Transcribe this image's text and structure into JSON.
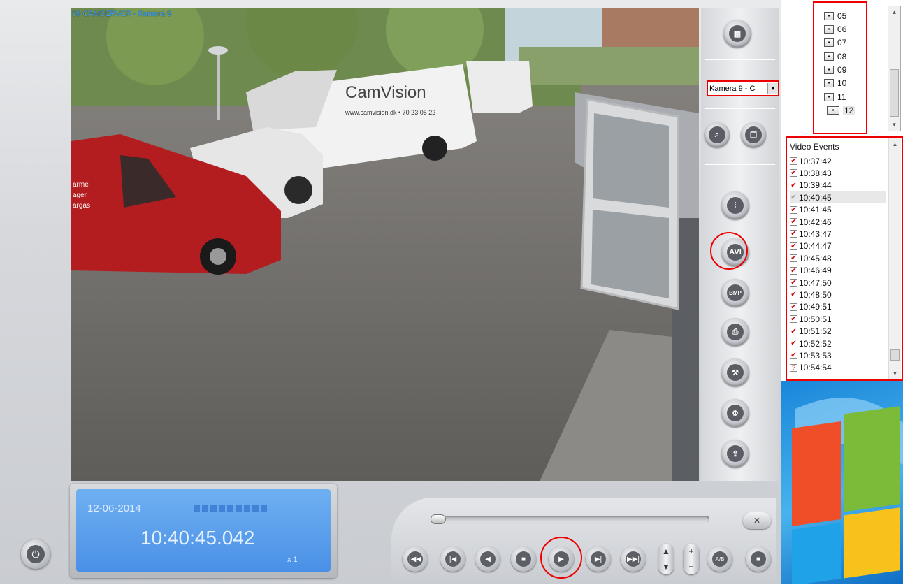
{
  "window": {
    "camera_title": "09 CAMSERVER - Kamera 9"
  },
  "video": {
    "van_logo": "CamVision",
    "van_url": "www.camvision.dk • 70 23 05 22",
    "red_van_text": [
      "arme",
      "ager",
      "argas"
    ]
  },
  "camera_select": {
    "value": "Kamera 9 - C",
    "arrow_icon": "dropdown-arrow-icon"
  },
  "right_buttons": [
    {
      "name": "camera-layout-button",
      "icon": "layout-grid-icon"
    },
    {
      "name": "search-button",
      "icon": "magnifier-icon"
    },
    {
      "name": "copy-button",
      "icon": "copy-pages-icon"
    },
    {
      "name": "adjust-button",
      "icon": "sliders-icon"
    },
    {
      "name": "save-avi-button",
      "icon": "floppy-avi-icon",
      "label": "AVI"
    },
    {
      "name": "save-bmp-button",
      "icon": "floppy-bmp-icon",
      "label": "BMP"
    },
    {
      "name": "print-button",
      "icon": "printer-icon"
    },
    {
      "name": "tools-button",
      "icon": "tools-icon"
    },
    {
      "name": "settings-button",
      "icon": "gear-wrench-icon"
    },
    {
      "name": "export-button",
      "icon": "export-icon"
    }
  ],
  "tree": {
    "items": [
      "05",
      "06",
      "07",
      "08",
      "09",
      "10",
      "11",
      "12"
    ]
  },
  "events": {
    "header": "Video Events",
    "items": [
      {
        "time": "10:37:42",
        "state": "checked"
      },
      {
        "time": "10:38:43",
        "state": "checked"
      },
      {
        "time": "10:39:44",
        "state": "checked"
      },
      {
        "time": "10:40:45",
        "state": "current"
      },
      {
        "time": "10:41:45",
        "state": "checked"
      },
      {
        "time": "10:42:46",
        "state": "checked"
      },
      {
        "time": "10:43:47",
        "state": "checked"
      },
      {
        "time": "10:44:47",
        "state": "checked"
      },
      {
        "time": "10:45:48",
        "state": "checked"
      },
      {
        "time": "10:46:49",
        "state": "checked"
      },
      {
        "time": "10:47:50",
        "state": "checked"
      },
      {
        "time": "10:48:50",
        "state": "checked"
      },
      {
        "time": "10:49:51",
        "state": "checked"
      },
      {
        "time": "10:50:51",
        "state": "checked"
      },
      {
        "time": "10:51:52",
        "state": "checked"
      },
      {
        "time": "10:52:52",
        "state": "checked"
      },
      {
        "time": "10:53:53",
        "state": "checked"
      },
      {
        "time": "10:54:54",
        "state": "unknown"
      }
    ]
  },
  "lcd": {
    "date": "12-06-2014",
    "time": "10:40:45.042",
    "speed": "x 1"
  },
  "transport": {
    "position_fraction": 0.0,
    "buttons": [
      {
        "name": "first-frame-button",
        "glyph": "|◀◀"
      },
      {
        "name": "prev-event-button",
        "glyph": "|◀"
      },
      {
        "name": "step-back-button",
        "glyph": "◀"
      },
      {
        "name": "stop-button",
        "glyph": "■"
      },
      {
        "name": "play-button",
        "glyph": "▶"
      },
      {
        "name": "next-event-button",
        "glyph": "▶|"
      },
      {
        "name": "last-frame-button",
        "glyph": "▶▶|"
      }
    ],
    "speed_pill": {
      "up": "▲",
      "down": "▼"
    },
    "zoom_pill": {
      "plus": "+",
      "minus": "−"
    },
    "ab_label": "A/B",
    "fullscreen_glyph": "■",
    "mute_glyph": "✕"
  },
  "power_glyph": "⏻",
  "colors": {
    "highlight": "#ee0000",
    "lcd": "#4a90e6"
  }
}
